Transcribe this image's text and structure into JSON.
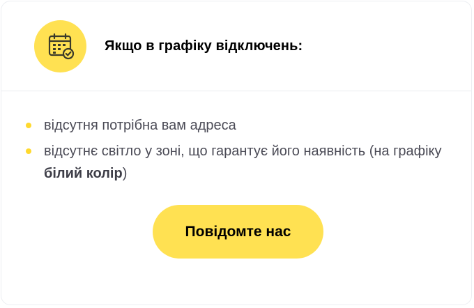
{
  "header": {
    "icon": "calendar-check-icon",
    "title": "Якщо в графіку відключень:"
  },
  "reasons": [
    {
      "text": "відсутня потрібна вам адреса"
    },
    {
      "text_before": "відсутнє світло у зоні, що гарантує його наявність (на графіку ",
      "text_bold": "білий колір",
      "text_after": ")"
    }
  ],
  "action": {
    "label": "Повідомте нас"
  },
  "colors": {
    "accent": "#ffe152",
    "bullet": "#ffd92e",
    "text": "#4b4b56",
    "icon_stroke": "#3a3a2a"
  }
}
